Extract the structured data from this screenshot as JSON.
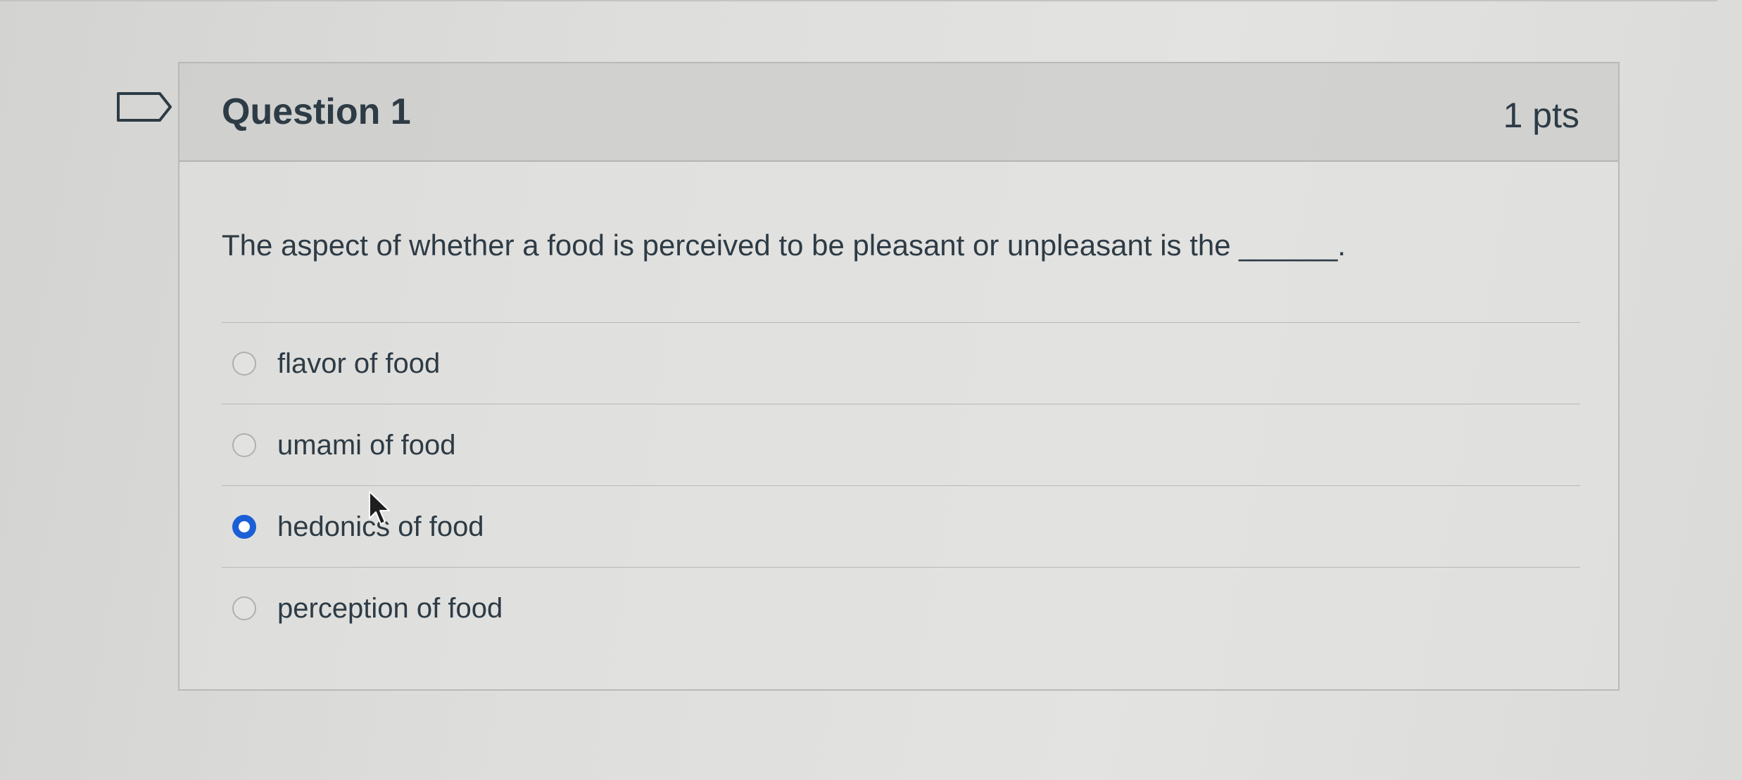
{
  "question": {
    "title": "Question 1",
    "points": "1 pts",
    "text": "The aspect of whether a food is perceived to be pleasant or unpleasant is the ______.",
    "answers": [
      {
        "label": "flavor of food",
        "selected": false
      },
      {
        "label": "umami of food",
        "selected": false
      },
      {
        "label": "hedonics of food",
        "selected": true
      },
      {
        "label": "perception of food",
        "selected": false
      }
    ]
  },
  "icons": {
    "flag": "flag-question-icon",
    "cursor": "mouse-pointer-icon"
  },
  "colors": {
    "selected_radio": "#1b5fd6",
    "text": "#2d3b45",
    "header_background": "#c4c4c2"
  }
}
